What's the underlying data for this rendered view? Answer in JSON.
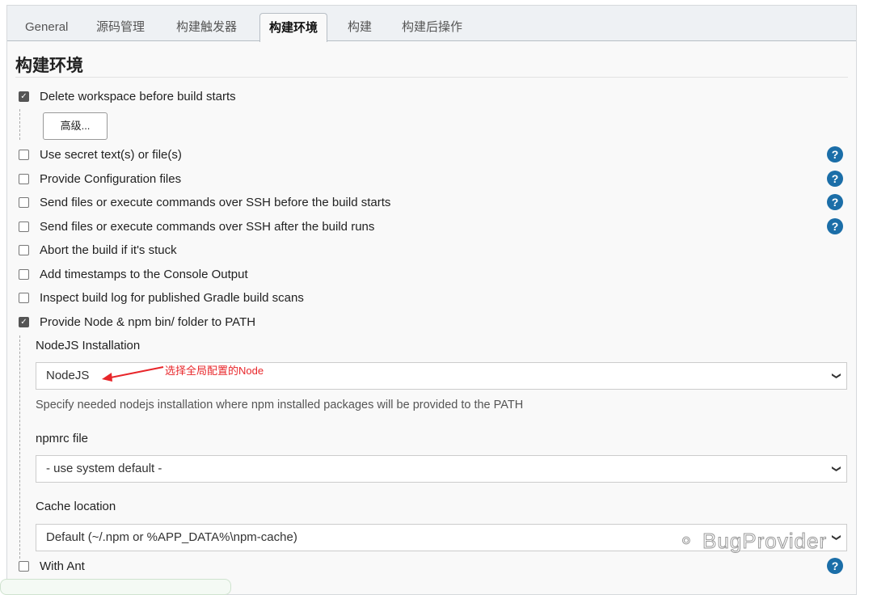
{
  "tabs": [
    {
      "label": "General"
    },
    {
      "label": "源码管理"
    },
    {
      "label": "构建触发器"
    },
    {
      "label": "构建环境",
      "active": true
    },
    {
      "label": "构建"
    },
    {
      "label": "构建后操作"
    }
  ],
  "section_title": "构建环境",
  "options": [
    {
      "label": "Delete workspace before build starts",
      "checked": true
    },
    {
      "label": "Use secret text(s) or file(s)",
      "checked": false,
      "help": true
    },
    {
      "label": "Provide Configuration files",
      "checked": false,
      "help": true
    },
    {
      "label": "Send files or execute commands over SSH before the build starts",
      "checked": false,
      "help": true
    },
    {
      "label": "Send files or execute commands over SSH after the build runs",
      "checked": false,
      "help": true
    },
    {
      "label": "Abort the build if it's stuck",
      "checked": false
    },
    {
      "label": "Add timestamps to the Console Output",
      "checked": false
    },
    {
      "label": "Inspect build log for published Gradle build scans",
      "checked": false
    },
    {
      "label": "Provide Node & npm bin/ folder to PATH",
      "checked": true
    },
    {
      "label": "With Ant",
      "checked": false,
      "help": true
    }
  ],
  "advanced_button": "高级...",
  "help_glyph": "?",
  "check_glyph": "✓",
  "node": {
    "installation_label": "NodeJS Installation",
    "installation_value": "NodeJS",
    "installation_desc": "Specify needed nodejs installation where npm installed packages will be provided to the PATH",
    "npmrc_label": "npmrc file",
    "npmrc_value": "- use system default -",
    "cache_label": "Cache location",
    "cache_value": "Default (~/.npm or %APP_DATA%\\npm-cache)"
  },
  "annotation": "选择全局配置的Node",
  "annotation_color": "#e8262a",
  "watermark": "BugProvider",
  "colors": {
    "help": "#1b6ea8",
    "tabbar": "#eef1f4"
  }
}
